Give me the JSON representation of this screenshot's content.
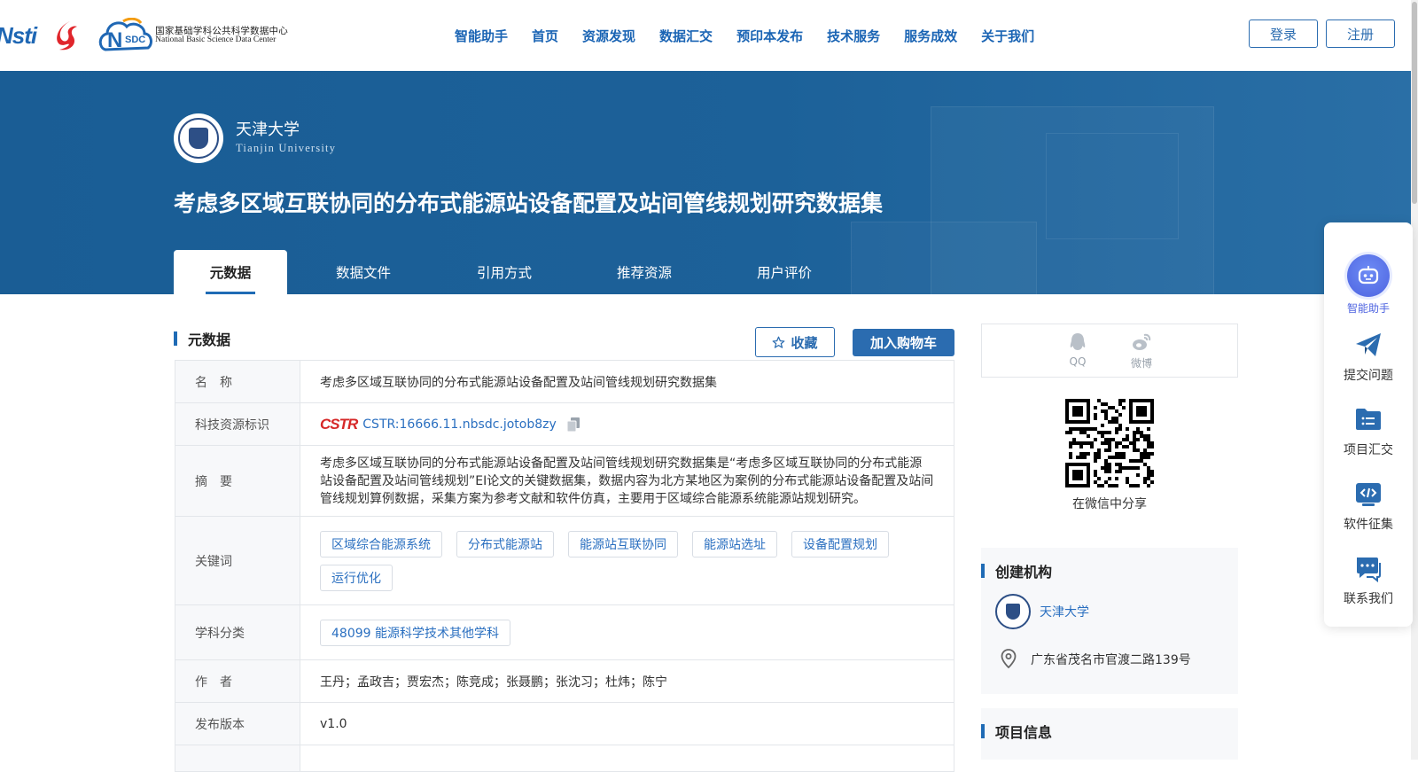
{
  "header": {
    "logos": {
      "nstl": "Nsti",
      "nsdc_cn": "国家基础学科公共科学数据中心",
      "nsdc_en": "National Basic Science Data Center"
    },
    "nav": [
      "智能助手",
      "首页",
      "资源发现",
      "数据汇交",
      "预印本发布",
      "技术服务",
      "服务成效",
      "关于我们"
    ],
    "login_label": "登录",
    "register_label": "注册"
  },
  "hero": {
    "institution_cn": "天津大学",
    "institution_en": "Tianjin University",
    "title": "考虑多区域互联协同的分布式能源站设备配置及站间管线规划研究数据集",
    "tabs": [
      "元数据",
      "数据文件",
      "引用方式",
      "推荐资源",
      "用户评价"
    ],
    "active_tab": "元数据"
  },
  "metadata_section": {
    "heading": "元数据",
    "favorite_label": "收藏",
    "cart_label": "加入购物车",
    "rows": {
      "name_key": "名　称",
      "name_value": "考虑多区域互联协同的分布式能源站设备配置及站间管线规划研究数据集",
      "cstr_key": "科技资源标识",
      "cstr_logo": "CSTR",
      "cstr_value": "CSTR:16666.11.nbsdc.jotob8zy",
      "abstract_key": "摘　要",
      "abstract_value": "考虑多区域互联协同的分布式能源站设备配置及站间管线规划研究数据集是“考虑多区域互联协同的分布式能源站设备配置及站间管线规划”EI论文的关键数据集，数据内容为北方某地区为案例的分布式能源站设备配置及站间管线规划算例数据，采集方案为参考文献和软件仿真，主要用于区域综合能源系统能源站规划研究。",
      "keywords_key": "关键词",
      "keywords": [
        "区域综合能源系统",
        "分布式能源站",
        "能源站互联协同",
        "能源站选址",
        "设备配置规划",
        "运行优化"
      ],
      "subject_key": "学科分类",
      "subject_value": "48099 能源科学技术其他学科",
      "authors_key": "作　者",
      "authors_value": "王丹；孟政吉；贾宏杰；陈竞成；张聂鹏；张沈习；杜炜；陈宁",
      "version_key": "发布版本",
      "version_value": "v1.0"
    }
  },
  "sidebar": {
    "share": {
      "qq": "QQ",
      "weibo": "微博",
      "wechat_caption": "在微信中分享"
    },
    "creator": {
      "heading": "创建机构",
      "org_name": "天津大学",
      "address": "广东省茂名市官渡二路139号"
    },
    "project_heading": "项目信息"
  },
  "float_menu": {
    "items": [
      "智能助手",
      "提交问题",
      "项目汇交",
      "软件征集",
      "联系我们"
    ]
  },
  "colors": {
    "primary": "#1f6bb5",
    "hero_bg": "#1c6199",
    "link": "#2a6fc0",
    "assistant_accent": "#4d63e0"
  }
}
